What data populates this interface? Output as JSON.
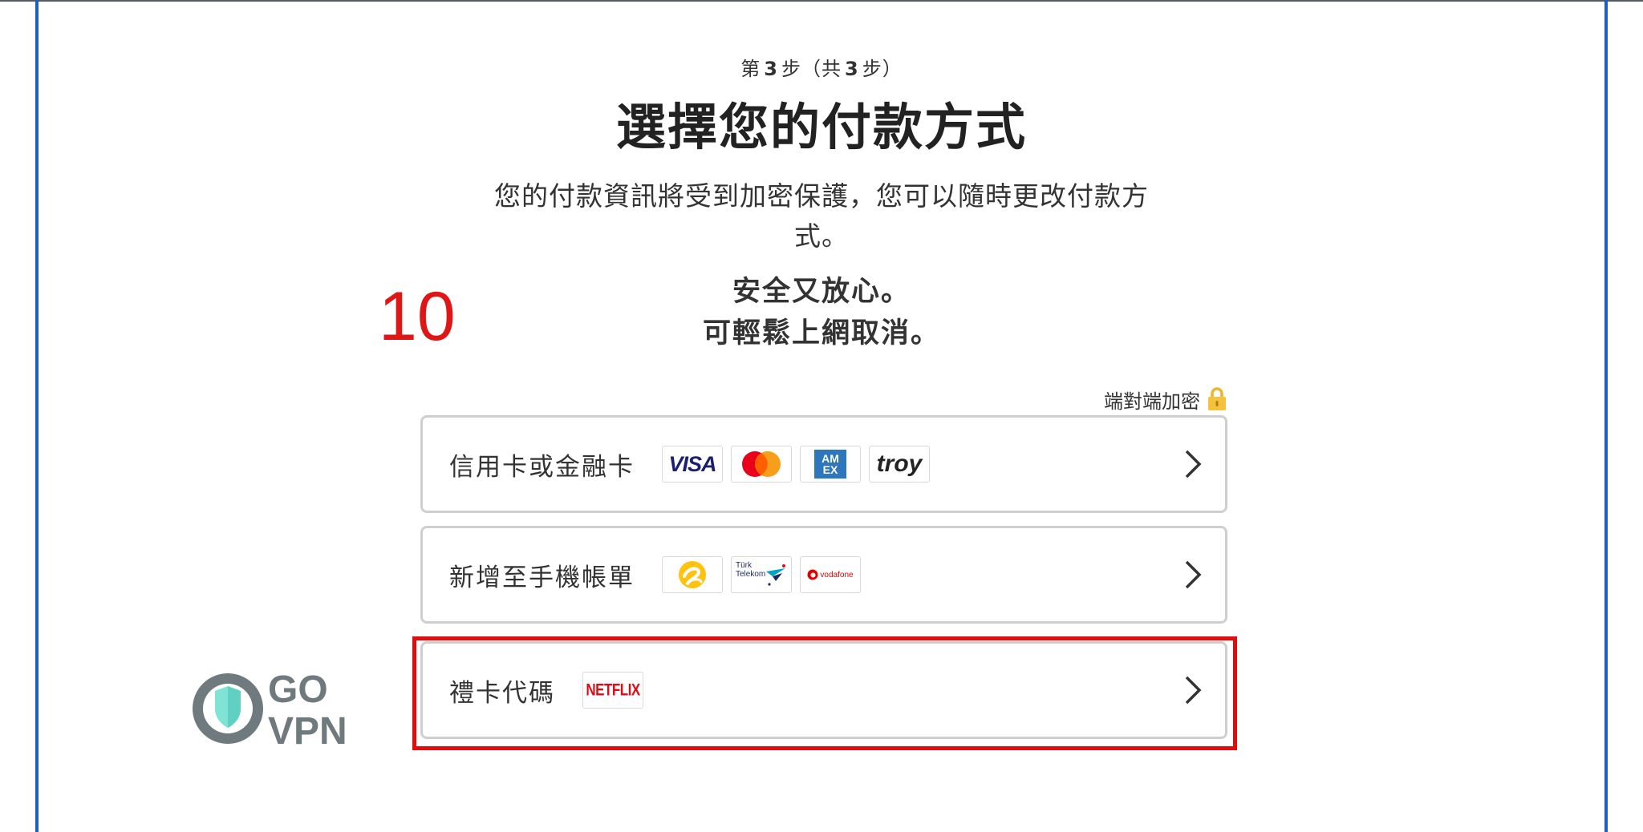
{
  "header": {
    "step_prefix": "第",
    "step_current": "3",
    "step_mid": "步（共",
    "step_total": "3",
    "step_suffix": "步）",
    "title": "選擇您的付款方式",
    "description_line1": "您的付款資訊將受到加密保護，您可以隨時更改付款方",
    "description_line2": "式。",
    "reassurance_line1": "安全又放心。",
    "reassurance_line2": "可輕鬆上網取消。"
  },
  "annotation": {
    "number": "10",
    "color": "#e01515"
  },
  "encryption": {
    "label": "端對端加密",
    "icon": "padlock-icon"
  },
  "payment_options": [
    {
      "label": "信用卡或金融卡",
      "logos": [
        "visa-logo",
        "mastercard-logo",
        "amex-logo",
        "troy-logo"
      ],
      "logo_text": {
        "visa": "VISA",
        "amex_top": "AM",
        "amex_bottom": "EX",
        "troy": "troy"
      }
    },
    {
      "label": "新增至手機帳單",
      "logos": [
        "turkcell-logo",
        "turk-telekom-logo",
        "vodafone-logo"
      ],
      "logo_text": {
        "telekom_line1": "Türk",
        "telekom_line2": "Telekom",
        "vodafone": "vodafone"
      }
    },
    {
      "label": "禮卡代碼",
      "logos": [
        "netflix-logo"
      ],
      "logo_text": {
        "netflix": "NETFLIX"
      },
      "highlighted": true
    }
  ],
  "watermark": {
    "line1": "GO",
    "line2": "VPN"
  },
  "colors": {
    "frame": "#1f5fbf",
    "highlight": "#e40b0b",
    "accent": "#e50914"
  }
}
